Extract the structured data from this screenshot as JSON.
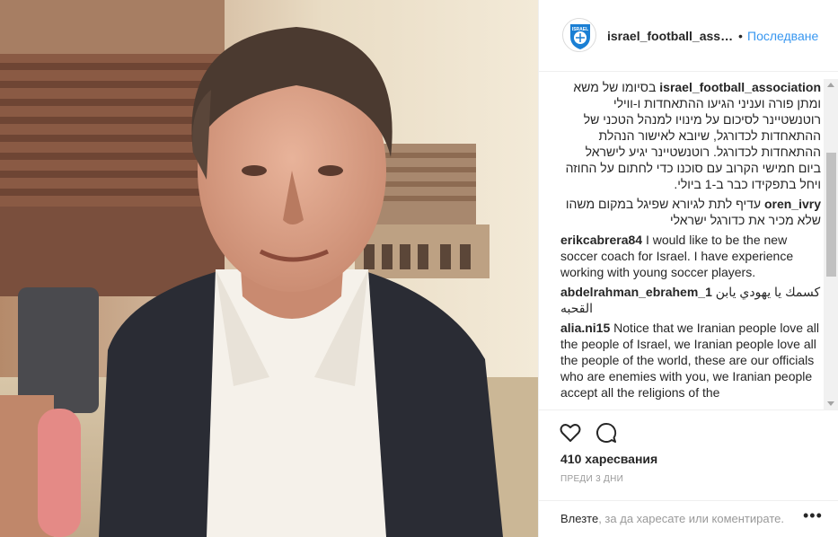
{
  "post": {
    "username": "israel_football_assoc...",
    "follow_separator": "•",
    "follow_label": "Последване",
    "avatar_text": "ISRAEL",
    "likes": "410 харесвания",
    "time": "ПРЕДИ 3 ДНИ"
  },
  "comments": [
    {
      "user": "israel_football_association",
      "text": "בסיומו של משא ומתן פורה ועניני הגיעו ההתאחדות ו-ווילי רוטנשטיינר לסיכום על מינויו למנהל הטכני של ההתאחדות לכדורגל, שיובא לאישור הנהלת ההתאחדות לכדורגל. רוטנשטיינר יגיע לישראל ביום חמישי הקרוב עם סוכנו כדי לחתום על החוזה ויחל בתפקידו כבר ב-1 ביולי.",
      "rtl": true
    },
    {
      "user": "oren_ivry",
      "text": "עדיף לתת לגיורא שפיגל במקום משהו שלא מכיר את כדורגל ישראלי",
      "rtl": true
    },
    {
      "user": "erikcabrera84",
      "text": "I would like to be the new soccer coach for Israel. I have experience working with young soccer players.",
      "rtl": false
    },
    {
      "user": "abdelrahman_ebrahem_1",
      "text": "كسمك يا يهودي يابن القحبه",
      "rtl": false
    },
    {
      "user": "alia.ni15",
      "text": "Notice that we Iranian people love all the people of Israel, we Iranian people love all the people of the world, these are our officials who are enemies with you, we Iranian people accept all the religions of the",
      "rtl": false
    }
  ],
  "login": {
    "link": "Влезте",
    "text": ", за да харесате или коментирате.",
    "more": "•••"
  },
  "icons": {
    "like": "heart-icon",
    "comment": "comment-bubble-icon",
    "more": "more-options-icon"
  },
  "colors": {
    "accent": "#3897f0",
    "text": "#262626",
    "muted": "#999999",
    "border": "#efefef"
  }
}
